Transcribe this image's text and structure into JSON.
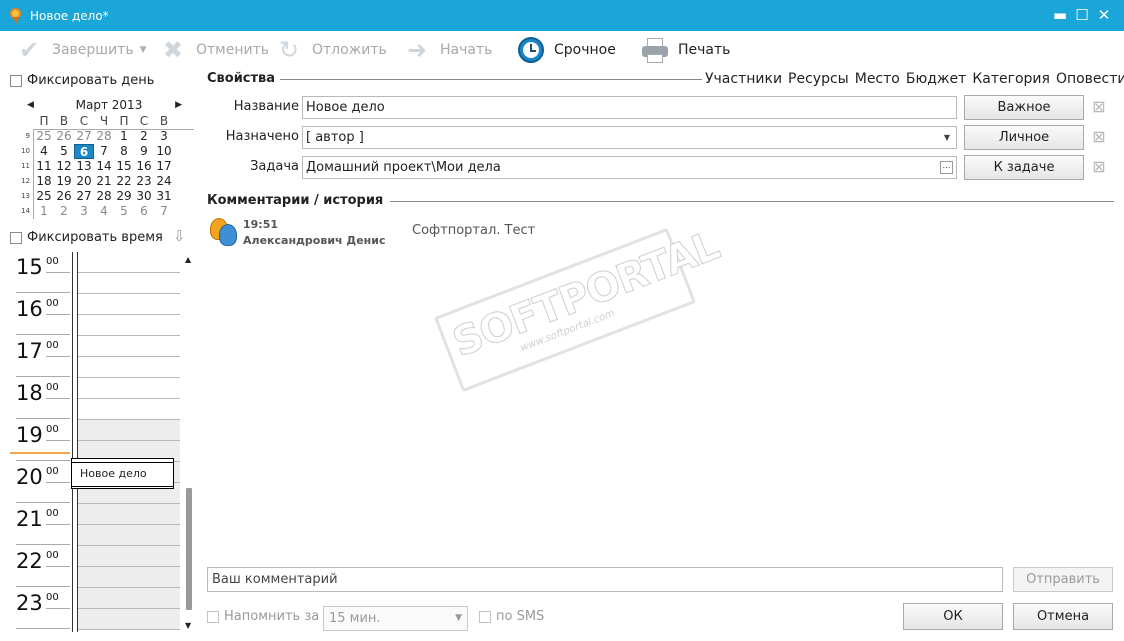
{
  "window": {
    "title": "Новое дело*",
    "minimize": "▬",
    "maximize": "☐",
    "close": "✕"
  },
  "toolbar": {
    "finish": "Завершить",
    "cancel": "Отменить",
    "postpone": "Отложить",
    "start": "Начать",
    "urgent": "Срочное",
    "print": "Печать"
  },
  "left": {
    "fix_day": "Фиксировать день",
    "fix_time": "Фиксировать время",
    "calendar": {
      "month": "Март 2013",
      "weekdays": [
        "П",
        "В",
        "С",
        "Ч",
        "П",
        "С",
        "В"
      ],
      "weeks": [
        {
          "num": "9",
          "days": [
            "25",
            "26",
            "27",
            "28",
            "1",
            "2",
            "3"
          ]
        },
        {
          "num": "10",
          "days": [
            "4",
            "5",
            "6",
            "7",
            "8",
            "9",
            "10"
          ]
        },
        {
          "num": "11",
          "days": [
            "11",
            "12",
            "13",
            "14",
            "15",
            "16",
            "17"
          ]
        },
        {
          "num": "12",
          "days": [
            "18",
            "19",
            "20",
            "21",
            "22",
            "23",
            "24"
          ]
        },
        {
          "num": "13",
          "days": [
            "25",
            "26",
            "27",
            "28",
            "29",
            "30",
            "31"
          ]
        },
        {
          "num": "14",
          "days": [
            "1",
            "2",
            "3",
            "4",
            "5",
            "6",
            "7"
          ]
        }
      ],
      "today": "6"
    },
    "hours": [
      "15",
      "16",
      "17",
      "18",
      "19",
      "20",
      "21",
      "22",
      "23"
    ],
    "minutes": "00",
    "event": "Новое дело"
  },
  "properties": {
    "title": "Свойства",
    "tabs": [
      "Участники",
      "Ресурсы",
      "Место",
      "Бюджет",
      "Категория",
      "Оповестить"
    ],
    "name_label": "Название",
    "name_value": "Новое дело",
    "assigned_label": "Назначено",
    "assigned_value": "[ автор ]",
    "task_label": "Задача",
    "task_value": "Домашний проект\\Мои дела",
    "important_btn": "Важное",
    "personal_btn": "Личное",
    "to_task_btn": "К задаче"
  },
  "comments": {
    "title": "Комментарии / история",
    "items": [
      {
        "time": "19:51",
        "author": "Александрович Денис",
        "text": "Софтпортал. Тест"
      }
    ],
    "input_placeholder": "Ваш комментарий",
    "send": "Отправить"
  },
  "watermark": {
    "brand": "SOFTPORTAL",
    "site": "www.softportal.com"
  },
  "footer": {
    "remind_label": "Напомнить за",
    "remind_value": "15 мин.",
    "sms_label": "по SMS",
    "ok": "ОК",
    "cancel": "Отмена"
  }
}
